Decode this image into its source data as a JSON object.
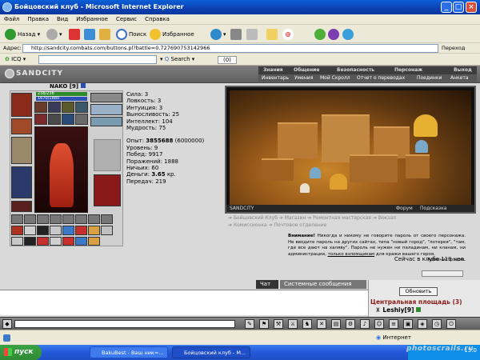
{
  "window": {
    "title": "Бойцовский клуб - Microsoft Internet Explorer"
  },
  "menu": [
    "Файл",
    "Правка",
    "Вид",
    "Избранное",
    "Сервис",
    "Справка"
  ],
  "toolbar": {
    "back": "Назад",
    "search": "Поиск",
    "favorites": "Избранное"
  },
  "address": {
    "label": "Адрес:",
    "url": "http://sandcity.combats.com/buttons.pl?battle=0.727690753142966",
    "go": "Переход"
  },
  "icqbar": {
    "icq": "ICQ",
    "search": "Search",
    "counter": "(0)"
  },
  "game": {
    "logo": "SANDCITY",
    "topnav": [
      "Знания",
      "Общение",
      "Безопасность",
      "Персонаж",
      "Выход"
    ],
    "subnav": [
      "Инвентарь",
      "Умения",
      "Мой Скролл",
      "Отчет о переводах",
      "Поединки",
      "Анкета"
    ]
  },
  "character": {
    "name": "NAKO",
    "level_tag": "[9]",
    "hp": "238/238",
    "mana": "1670/1880",
    "stats": [
      {
        "label": "Сила:",
        "value": "3"
      },
      {
        "label": "Ловкость:",
        "value": "3"
      },
      {
        "label": "Интуиция:",
        "value": "3"
      },
      {
        "label": "Выносливость:",
        "value": "25"
      },
      {
        "label": "Интеллект:",
        "value": "104"
      },
      {
        "label": "Мудрость:",
        "value": "75"
      }
    ],
    "experience_label": "Опыт:",
    "experience": "3855688",
    "experience_next": "(6000000)",
    "details": [
      {
        "label": "Уровень:",
        "value": "9"
      },
      {
        "label": "Побед:",
        "value": "9917"
      },
      {
        "label": "Поражений:",
        "value": "1888"
      },
      {
        "label": "Ничьих:",
        "value": "60"
      }
    ],
    "money_label": "Деньги:",
    "money": "3.65",
    "money_unit": "кр.",
    "transfers_label": "Передач:",
    "transfers": "219"
  },
  "view": {
    "caption": "SANDCITY",
    "forum": "Форум",
    "help": "Подсказка"
  },
  "links": [
    "Бойцовский Клуб",
    "Магазин",
    "Ремонтная мастерская",
    "Вокзал",
    "Комиссионка",
    "Почтовое отделение"
  ],
  "warning": {
    "title": "Внимание!",
    "text": "Никогда и никому не говорите пароль от своего персонажа. Не вводите пароль на других сайтах, типа \"новый город\", \"лотерея\", \"там, где все дают на халяву\". Пароль не нужен ни паладинам, ни кланам, ни администрации,",
    "underlined": "только взломщикам",
    "tail": "для кражи вашего героя.",
    "signature": "Администрация."
  },
  "online": {
    "text": "Сейчас в клубе 119 чел."
  },
  "tabs": [
    "Чат",
    "Системные сообщения"
  ],
  "side": {
    "refresh": "Обновить",
    "location": "Центральная площадь (3)",
    "player": "Leshiy",
    "player_level": "[9]"
  },
  "status": {
    "zone": "Интернет"
  },
  "taskbar": {
    "start": "пуск",
    "tasks": [
      "BakuBest - Ваш ник=...",
      "Бойцовский клуб - M..."
    ],
    "clock": "13:0"
  },
  "watermark": "photoscrails.ru",
  "colors": {
    "hp": "#2e8b2e",
    "mana": "#2b4fb5",
    "taskbar": "#2357d6",
    "start": "#2e8b34"
  }
}
